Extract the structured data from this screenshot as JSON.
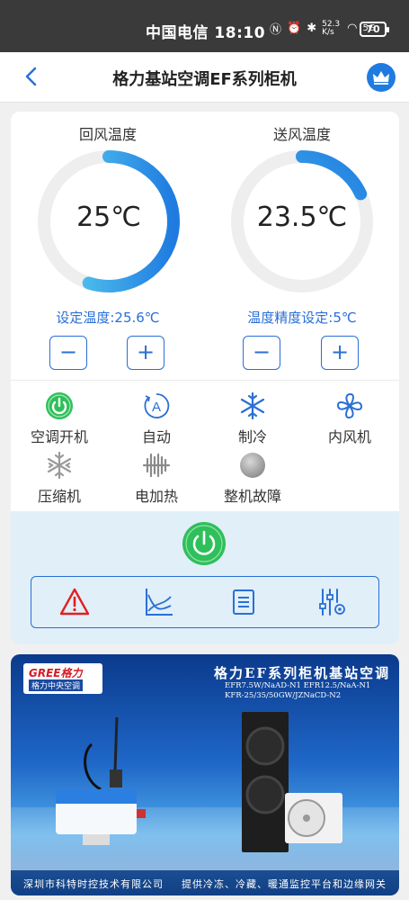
{
  "status_bar": {
    "carrier": "中国电信",
    "time": "18:10",
    "net_speed": "52.3 K/s",
    "signal": "5G",
    "battery": "70"
  },
  "nav": {
    "title": "格力基站空调EF系列柜机"
  },
  "gauges": {
    "return_air": {
      "label": "回风温度",
      "value": "25℃",
      "fill_fraction": 0.55
    },
    "supply_air": {
      "label": "送风温度",
      "value": "23.5℃",
      "fill_fraction": 0.18
    }
  },
  "settings": {
    "set_temp": "设定温度:25.6℃",
    "precision": "温度精度设定:5℃",
    "minus": "−",
    "plus": "+"
  },
  "statuses": [
    {
      "label": "空调开机",
      "icon": "power-on-icon",
      "color": "#2ec05a"
    },
    {
      "label": "自动",
      "icon": "auto-mode-icon",
      "color": "#2a6fd6"
    },
    {
      "label": "制冷",
      "icon": "snowflake-icon",
      "color": "#2a6fd6"
    },
    {
      "label": "内风机",
      "icon": "fan-icon",
      "color": "#2a6fd6"
    },
    {
      "label": "压缩机",
      "icon": "compressor-snowflake-icon",
      "color": "#9a9a9a"
    },
    {
      "label": "电加热",
      "icon": "heater-icon",
      "color": "#9a9a9a"
    },
    {
      "label": "整机故障",
      "icon": "fault-indicator-icon",
      "color": "#9a9a9a"
    }
  ],
  "banner": {
    "logo_brand": "GREE格力",
    "logo_sub": "格力中央空调",
    "title": "格力EF系列柜机基站空调",
    "models": [
      "EFR7.5W/NaAD-N1 EFR12.5/NaA-N1",
      "KFR-25/35/50GW/JZNaCD-N2"
    ],
    "footer_left": "深圳市科特时控技术有限公司",
    "footer_right": "提供冷冻、冷藏、暖通监控平台和边缘网关"
  },
  "colors": {
    "accent": "#2a6fd6",
    "gauge_gradient_start": "#1f7be0",
    "gauge_gradient_end": "#5fd6f2",
    "power_green": "#2ec05a",
    "alarm_red": "#e02020"
  }
}
